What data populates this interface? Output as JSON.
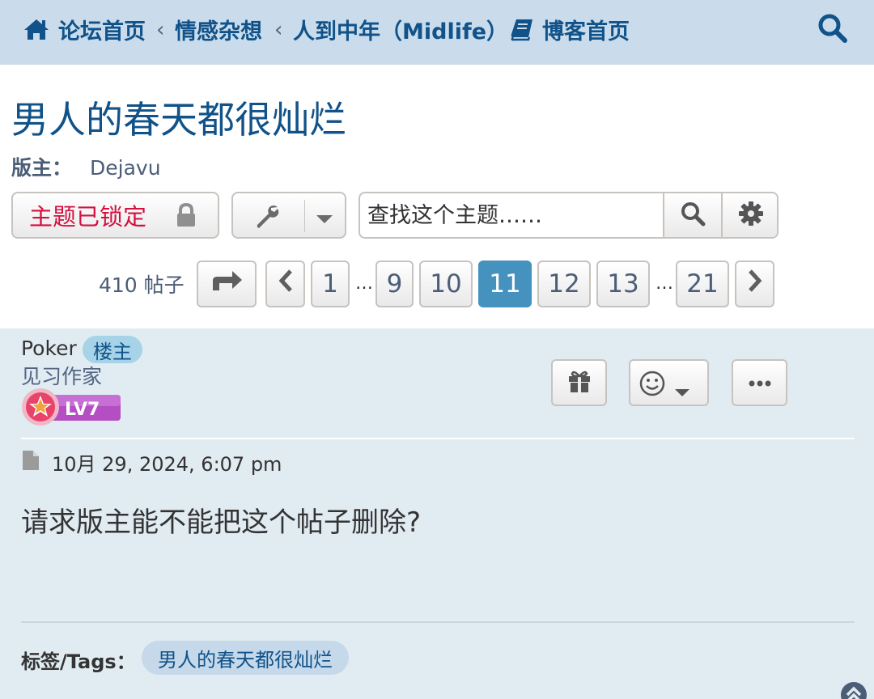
{
  "nav": {
    "home": "论坛首页",
    "crumb1": "情感杂想",
    "crumb2": "人到中年（Midlife）",
    "blog": "博客首页",
    "sep": "‹"
  },
  "topic": {
    "title": "男人的春天都很灿烂",
    "moderator_label": "版主：",
    "moderator": "Dejavu",
    "locked_label": "主题已锁定"
  },
  "search": {
    "placeholder": "查找这个主题……"
  },
  "pagination": {
    "count": "410 帖子",
    "pages": [
      "1",
      "9",
      "10",
      "11",
      "12",
      "13",
      "21"
    ],
    "current": "11",
    "ellipsis": "…"
  },
  "post": {
    "author": "Poker",
    "badge": "楼主",
    "rank": "见习作家",
    "level": "LV7",
    "date": "10月 29, 2024, 6:07 pm",
    "content": "请求版主能不能把这个帖子删除?"
  },
  "tags": {
    "label": "标签/Tags：",
    "items": [
      "男人的春天都很灿烂"
    ]
  },
  "colors": {
    "link": "#105289",
    "active_page": "#4692bf",
    "locked": "#d31141",
    "post_bg": "#e1ebf2",
    "nav_bg": "#cadceb"
  },
  "icons": [
    "home-icon",
    "book-icon",
    "search-icon",
    "lock-icon",
    "wrench-icon",
    "caret-down-icon",
    "gear-icon",
    "reply-arrow-icon",
    "chevron-left-icon",
    "chevron-right-icon",
    "gift-icon",
    "smiley-icon",
    "ellipsis-icon",
    "document-icon",
    "scroll-top-icon"
  ]
}
